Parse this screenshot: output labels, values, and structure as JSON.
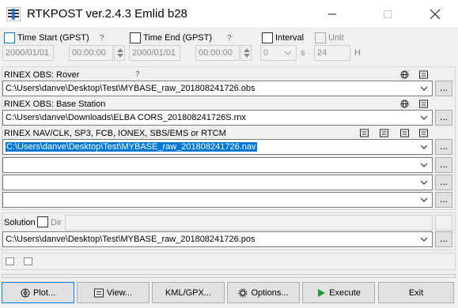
{
  "window": {
    "title": "RTKPOST ver.2.4.3 Emlid b28"
  },
  "time": {
    "start": {
      "label": "Time Start (GPST)",
      "help": "?",
      "date": "2000/01/01",
      "time": "00:00:00"
    },
    "end": {
      "label": "Time End (GPST)",
      "help": "?",
      "date": "2000/01/01",
      "time": "00:00:00"
    },
    "interval": {
      "label": "Interval",
      "value": "0",
      "unit": "s"
    },
    "unit": {
      "label": "Unit",
      "value": "24",
      "unit": "H"
    }
  },
  "inputs": {
    "rover": {
      "label": "RINEX OBS: Rover",
      "help": "?",
      "path": "C:\\Users\\danve\\Desktop\\Test\\MYBASE_raw_201808241726.obs"
    },
    "base": {
      "label": "RINEX OBS: Base Station",
      "path": "C:\\Users\\danve\\Downloads\\ELBA CORS_201808241726S.rnx"
    },
    "nav": {
      "label": "RINEX NAV/CLK, SP3, FCB, IONEX, SBS/EMS  or RTCM",
      "paths": [
        "C:\\Users\\danve\\Desktop\\Test\\MYBASE_raw_201808241726.nav",
        "",
        "",
        "",
        ""
      ]
    },
    "browse_label": "..."
  },
  "solution": {
    "label": "Solution",
    "dir_label": "Dir",
    "dir_value": "",
    "path": "C:\\Users\\danve\\Desktop\\Test\\MYBASE_raw_201808241726.pos"
  },
  "buttons": {
    "plot": "Plot...",
    "view": "View...",
    "kml": "KML/GPX...",
    "options": "Options...",
    "execute": "Execute",
    "exit": "Exit"
  },
  "colors": {
    "accent": "#0078d7",
    "execute_icon": "#1e9e3a"
  }
}
